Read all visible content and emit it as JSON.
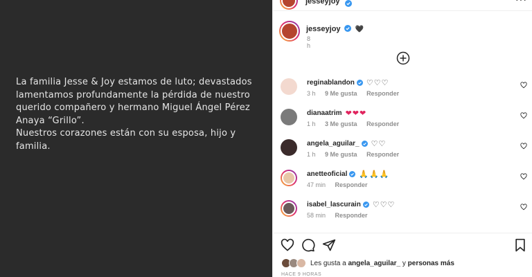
{
  "post": {
    "caption_lines": [
      "La familia Jesse & Joy estamos de luto; devastados",
      "lamentamos profundamente la pérdida de nuestro",
      "querido compañero y hermano Miguel Ángel Pérez",
      "Anaya “Grillo”.",
      "Nuestros corazones están con su esposa, hijo y",
      "familia."
    ]
  },
  "header": {
    "username": "jesseyjoy",
    "more_label": "···"
  },
  "caption": {
    "username": "jesseyjoy",
    "emoji": "🖤",
    "time": "8 h"
  },
  "comments": [
    {
      "username": "reginablandon",
      "verified": true,
      "text": "♡♡♡",
      "time": "3 h",
      "likes": "9 Me gusta",
      "reply": "Responder",
      "avatar_color": "#f3d9cf"
    },
    {
      "username": "dianaatrim",
      "verified": false,
      "text": "❤❤❤",
      "text_color": "#e0245e",
      "time": "1 h",
      "likes": "3 Me gusta",
      "reply": "Responder",
      "avatar_color": "#7a7a7a"
    },
    {
      "username": "angela_aguilar_",
      "verified": true,
      "text": "♡♡",
      "time": "1 h",
      "likes": "9 Me gusta",
      "reply": "Responder",
      "avatar_color": "#3b2b2b"
    },
    {
      "username": "anetteoficial",
      "verified": true,
      "text": "🙏🙏🙏",
      "time": "47 min",
      "likes": "",
      "reply": "Responder",
      "avatar_color": "#e8c7a8",
      "ring": true
    },
    {
      "username": "isabel_lascurain",
      "verified": true,
      "text": "♡♡♡",
      "time": "58 min",
      "likes": "",
      "reply": "Responder",
      "avatar_color": "#6b5a5a",
      "ring": true
    }
  ],
  "likes": {
    "prefix": "Les gusta a",
    "user": "angela_aguilar_",
    "joiner": "y",
    "others": "personas más"
  },
  "time_ago": "HACE 9 HORAS",
  "colors": {
    "verified": "#3897f0",
    "post_bg": "#2b2b2b",
    "muted": "#8e8e8e"
  }
}
